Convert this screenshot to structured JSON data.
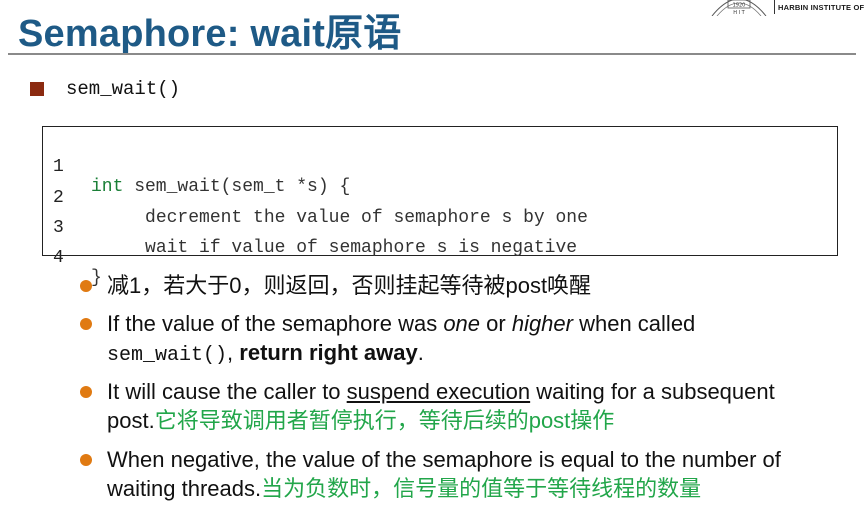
{
  "header": {
    "title": "Semaphore: wait原语",
    "logo_text": "HARBIN INSTITUTE OF T",
    "logo_year": "1920",
    "logo_letters": "H I T"
  },
  "subheading": {
    "text": "sem_wait()"
  },
  "code": {
    "lines": [
      {
        "number": "1",
        "keyword": "int",
        "rest": " sem_wait(sem_t *s) {",
        "indent": ""
      },
      {
        "number": "2",
        "keyword": "",
        "rest": "decrement the value of semaphore s by one",
        "indent": "     "
      },
      {
        "number": "3",
        "keyword": "",
        "rest": "wait if value of semaphore s is negative",
        "indent": "     "
      },
      {
        "number": "4",
        "keyword": "",
        "rest": "}",
        "indent": ""
      }
    ]
  },
  "bullets": [
    {
      "line1": "减1，若大于0，则返回，否则挂起等待被post唤醒"
    },
    {
      "line1_a": "If the value of the semaphore was ",
      "line1_b": "one",
      "line1_c": " or ",
      "line1_d": "higher",
      "line1_e": " when called",
      "line2_code": "sem_wait()",
      "line2_b": ", ",
      "line2_bold": "return right away",
      "line2_c": "."
    },
    {
      "line1_a": "It will cause the caller to ",
      "line1_u": "suspend execution",
      "line1_b": " waiting for a subsequent",
      "line2_a": "post.",
      "line2_zh": "它将导致调用者暂停执行，等待后续的post操作"
    },
    {
      "line1": "When negative, the value of the semaphore is equal to the number of",
      "line2_a": "waiting threads.",
      "line2_zh": "当为负数时，信号量的值等于等待线程的数量"
    }
  ],
  "colors": {
    "title": "#1e5a86",
    "bullet": "#e07a12",
    "square_marker": "#8b2a10",
    "keyword": "#1a7f37",
    "chinese_note": "#22a64a"
  }
}
